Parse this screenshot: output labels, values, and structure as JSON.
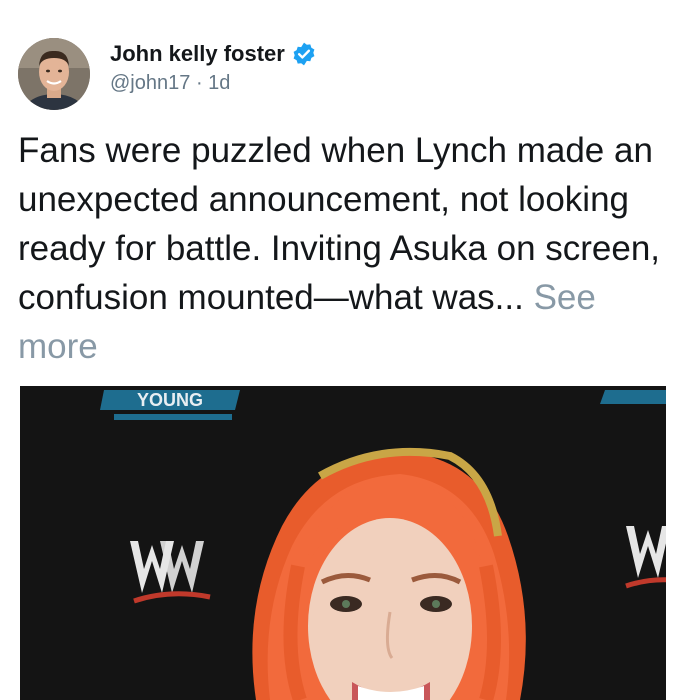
{
  "post": {
    "author": {
      "name": "John kelly foster",
      "handle": "@john17",
      "time_sep": "·",
      "time": "1d",
      "verified": true
    },
    "text": "Fans were puzzled when Lynch made an unexpected announcement, not looking ready for battle. Inviting Asuka on screen, confusion mounted—what was...",
    "see_more": "See more",
    "media": {
      "backdrop_text": "YOUNG",
      "logos": [
        "wwe-logo",
        "wwe-logo"
      ]
    }
  },
  "colors": {
    "verified_badge": "#1da1f2",
    "text_primary": "#14171a",
    "text_secondary": "#657786",
    "see_more": "#8899a6",
    "hair": "#f26a3c",
    "backdrop": "#141414"
  }
}
